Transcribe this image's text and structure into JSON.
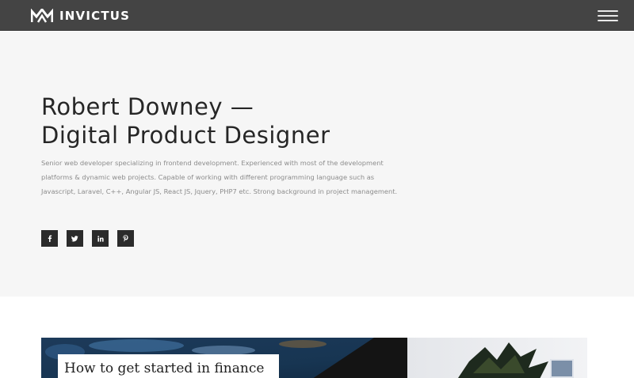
{
  "header": {
    "brand": "INVICTUS",
    "menu_icon": "hamburger-menu-icon"
  },
  "hero": {
    "title_line1": "Robert Downey —",
    "title_line2": "Digital Product Designer",
    "description": "Senior web developer specializing in frontend development. Experienced with most of the development platforms & dynamic web projects. Capable of working with different programming language such as Javascript, Laravel, C++, Angular JS, React JS, Jquery, PHP7 etc. Strong background in project management.",
    "social_icons": [
      "facebook-icon",
      "twitter-icon",
      "linkedin-icon",
      "pinterest-icon"
    ]
  },
  "featured_post": {
    "title": "How to get started in finance"
  },
  "colors": {
    "navbar": "#444444",
    "hero_background": "#f6f6f6",
    "social_button": "#2b2b2b",
    "title_text": "#262626",
    "body_text": "#8c8c8c"
  }
}
